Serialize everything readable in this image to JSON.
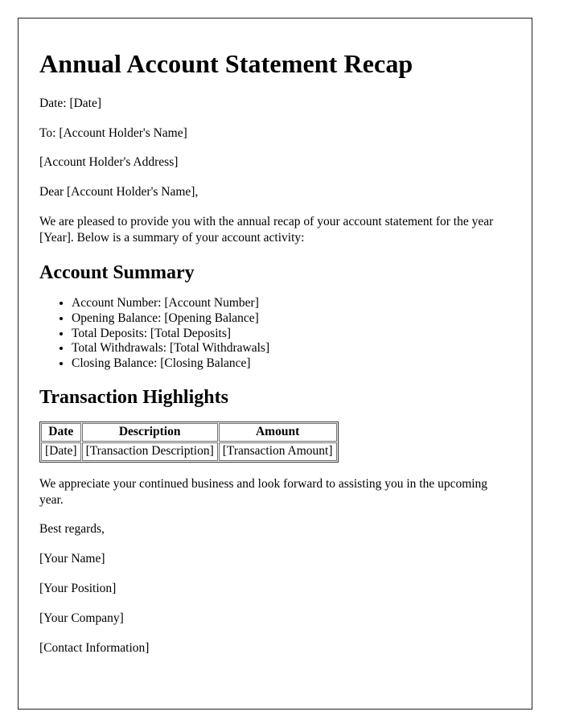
{
  "document": {
    "title": "Annual Account Statement Recap",
    "date_line": "Date: [Date]",
    "to_line": "To: [Account Holder's Name]",
    "address_line": "[Account Holder's Address]",
    "salutation": "Dear [Account Holder's Name],",
    "intro_paragraph": "We are pleased to provide you with the annual recap of your account statement for the year [Year]. Below is a summary of your account activity:",
    "closing_paragraph": "We appreciate your continued business and look forward to assisting you in the upcoming year.",
    "sign_off": "Best regards,",
    "signature_lines": [
      "[Your Name]",
      "[Your Position]",
      "[Your Company]",
      "[Contact Information]"
    ]
  },
  "account_summary": {
    "heading": "Account Summary",
    "items": [
      "Account Number: [Account Number]",
      "Opening Balance: [Opening Balance]",
      "Total Deposits: [Total Deposits]",
      "Total Withdrawals: [Total Withdrawals]",
      "Closing Balance: [Closing Balance]"
    ]
  },
  "transaction_highlights": {
    "heading": "Transaction Highlights",
    "columns": [
      "Date",
      "Description",
      "Amount"
    ],
    "rows": [
      [
        "[Date]",
        "[Transaction Description]",
        "[Transaction Amount]"
      ]
    ]
  },
  "colors": {
    "text": "#000000",
    "page_border": "#222222",
    "table_border": "#6f6f6f",
    "background": "#ffffff"
  }
}
